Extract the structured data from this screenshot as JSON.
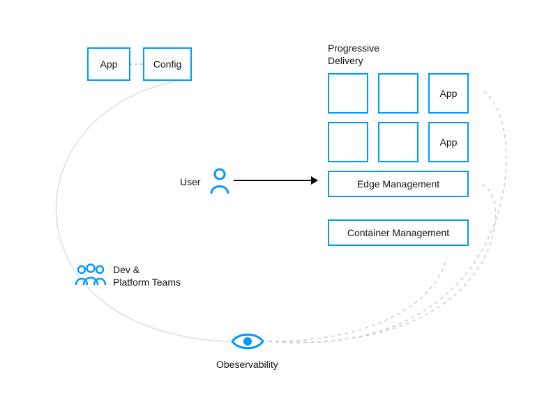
{
  "boxes": {
    "app": "App",
    "config": "Config",
    "pd_app1": "App",
    "pd_app2": "App"
  },
  "labels": {
    "progressive_delivery": "Progressive Delivery",
    "user": "User",
    "edge_management": "Edge Management",
    "container_management": "Container Management",
    "dev_platform_teams": "Dev &\nPlatform Teams",
    "observability": "Obeservability"
  },
  "colors": {
    "accent": "#0099ff",
    "text": "#111111"
  }
}
